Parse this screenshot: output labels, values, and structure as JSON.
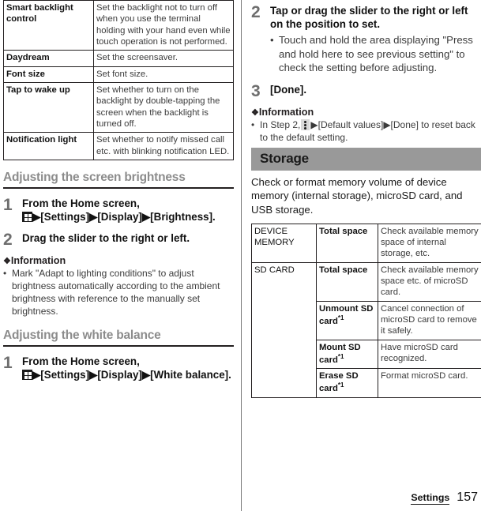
{
  "footer": {
    "label": "Settings",
    "page_number": "157"
  },
  "icons": {
    "app_drawer": "app-drawer-grid-icon",
    "overflow_menu": "vertical-dots-menu-icon",
    "arrow": "▶",
    "diamond": "❖",
    "bullet": "•"
  },
  "left_column": {
    "display_settings_table": {
      "rows": [
        {
          "key": "Smart backlight control",
          "value": "Set the backlight not to turn off when you use the terminal holding with your hand even while touch operation is not performed."
        },
        {
          "key": "Daydream",
          "value": "Set the screensaver."
        },
        {
          "key": "Font size",
          "value": "Set font size."
        },
        {
          "key": "Tap to wake up",
          "value": "Set whether to turn on the backlight by double-tapping the screen when the backlight is turned off."
        },
        {
          "key": "Notification light",
          "value": "Set whether to notify missed call etc. with blinking notification LED."
        }
      ]
    },
    "section_brightness": {
      "heading": "Adjusting the screen brightness",
      "steps": [
        {
          "number": "1",
          "text_before_icon": "From the Home screen,",
          "path": "▶[Settings]▶[Display]▶[Brightness]."
        },
        {
          "number": "2",
          "text": "Drag the slider to the right or left."
        }
      ],
      "information": {
        "heading": "Information",
        "items": [
          "Mark \"Adapt to lighting conditions\" to adjust brightness automatically according to the ambient brightness with reference to the manually set brightness."
        ]
      }
    },
    "section_white_balance": {
      "heading": "Adjusting the white balance",
      "steps": [
        {
          "number": "1",
          "text_before_icon": "From the Home screen,",
          "path": "▶[Settings]▶[Display]▶[White balance]."
        }
      ]
    }
  },
  "right_column": {
    "steps": [
      {
        "number": "2",
        "text": "Tap or drag the slider to the right or left on the position to set.",
        "sub_items": [
          "Touch and hold the area displaying \"Press and hold here to see previous setting\" to check the setting before adjusting."
        ]
      },
      {
        "number": "3",
        "text": "[Done]."
      }
    ],
    "information": {
      "heading": "Information",
      "item_prefix": "In Step 2,",
      "item_suffix": "▶[Default values]▶[Done] to reset back to the default setting."
    },
    "storage_section": {
      "banner_title": "Storage",
      "intro": "Check or format memory volume of device memory (internal storage), microSD card, and USB storage.",
      "table": {
        "rows": [
          {
            "group": "DEVICE MEMORY",
            "group_rowspan": 1,
            "key": "Total space",
            "footnote": "",
            "value": "Check available memory space of internal storage, etc."
          },
          {
            "group": "SD CARD",
            "group_rowspan": 4,
            "key": "Total space",
            "footnote": "",
            "value": "Check available memory space etc. of microSD card."
          },
          {
            "group": "",
            "group_rowspan": 0,
            "key": "Unmount SD card",
            "footnote": "*1",
            "value": "Cancel connection of microSD card to remove it safely."
          },
          {
            "group": "",
            "group_rowspan": 0,
            "key": "Mount SD card",
            "footnote": "*1",
            "value": "Have microSD card recognized."
          },
          {
            "group": "",
            "group_rowspan": 0,
            "key": "Erase SD card",
            "footnote": "*1",
            "value": "Format microSD card."
          }
        ]
      }
    }
  }
}
